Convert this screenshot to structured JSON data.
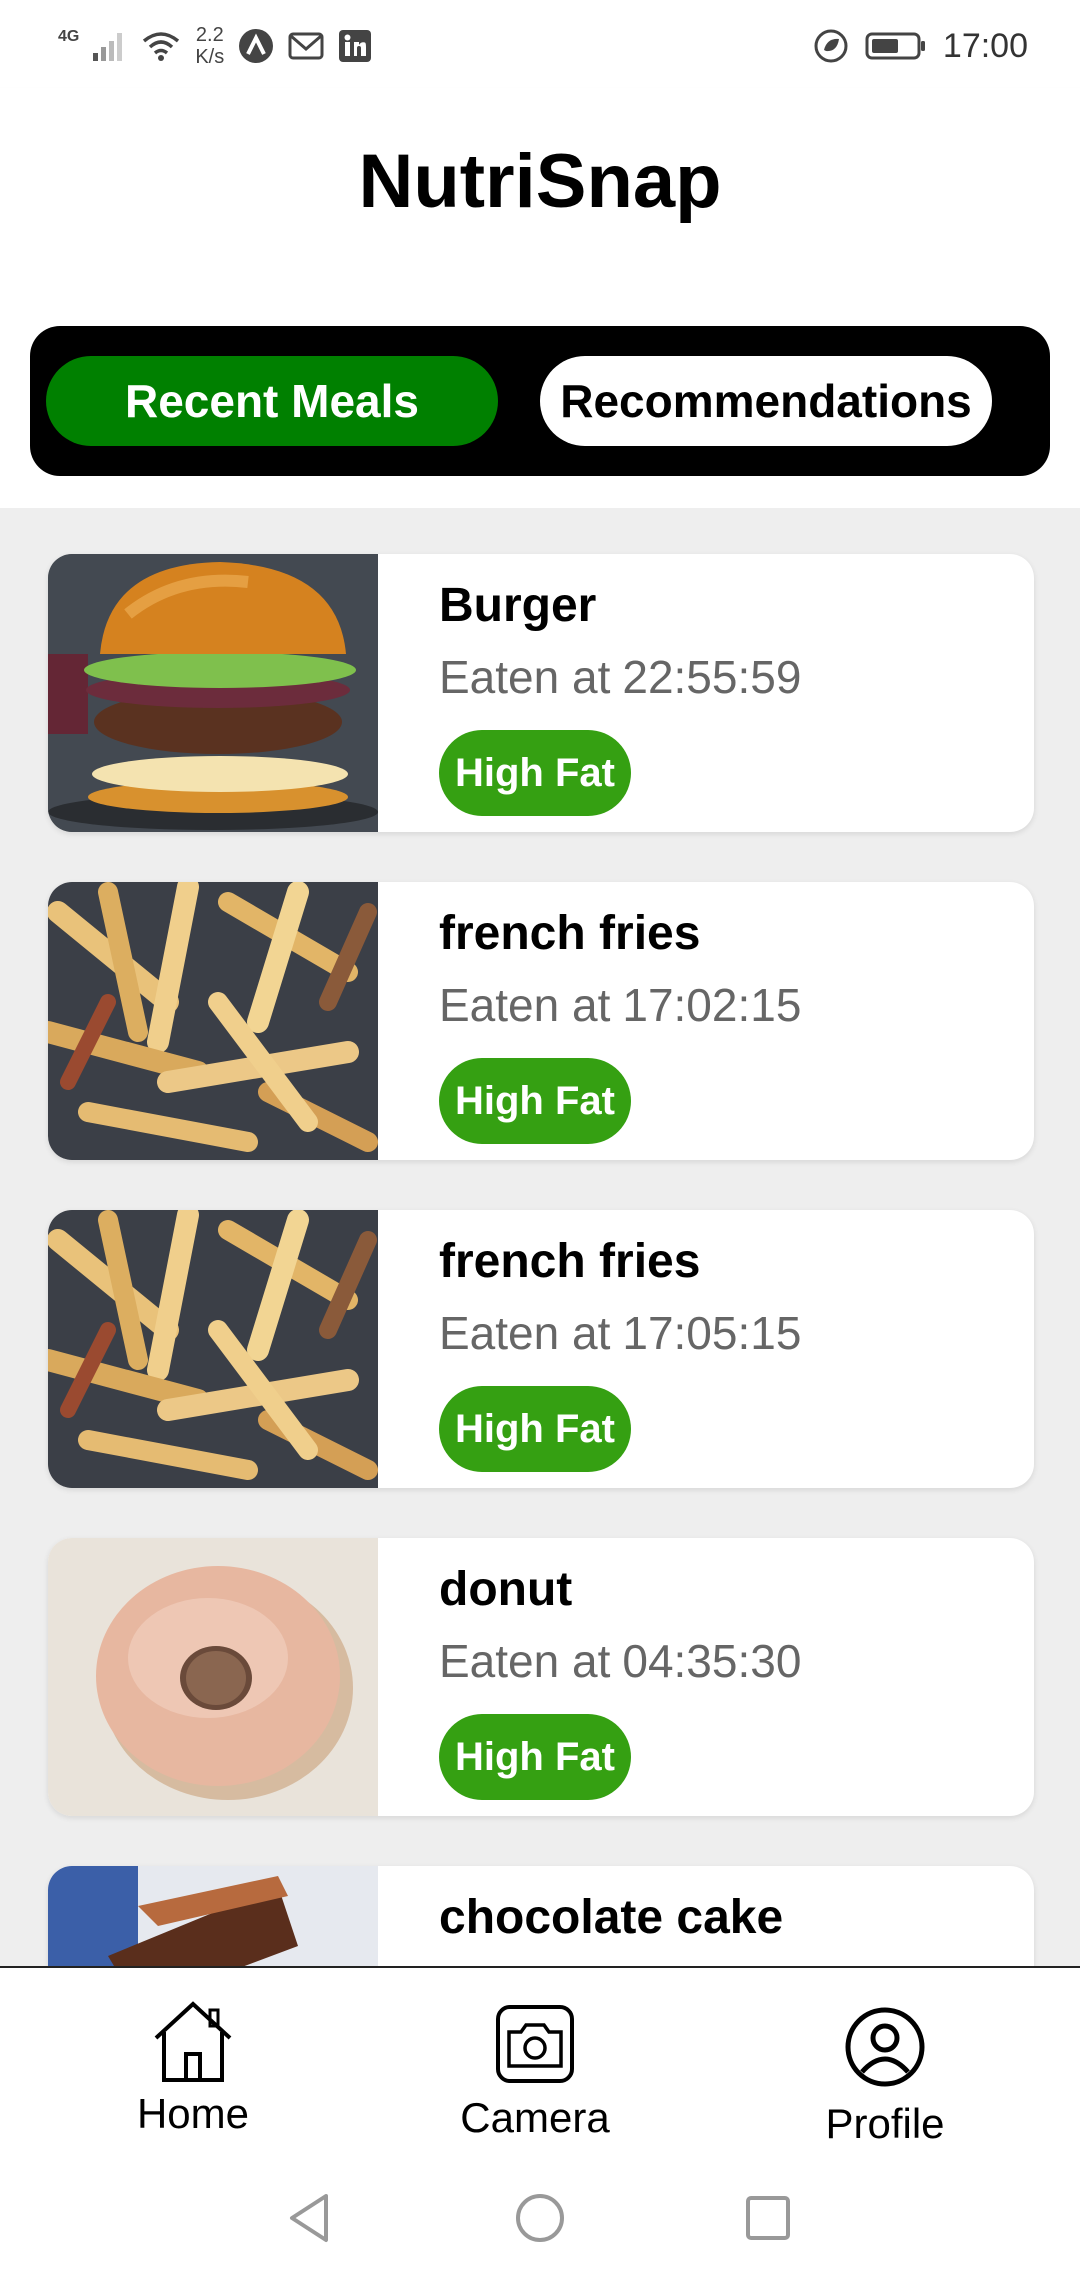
{
  "status_bar": {
    "network_type": "4G",
    "speed_value": "2.2",
    "speed_unit": "K/s",
    "time": "17:00",
    "icons": [
      "signal-icon",
      "wifi-icon",
      "app-a-icon",
      "gmail-icon",
      "linkedin-icon",
      "eco-icon",
      "battery-icon"
    ]
  },
  "header": {
    "title": "NutriSnap"
  },
  "tabs": [
    {
      "label": "Recent Meals",
      "active": true
    },
    {
      "label": "Recommendations",
      "active": false
    }
  ],
  "meals": [
    {
      "name": "Burger",
      "time_prefix": "Eaten at",
      "time": "22:55:59",
      "badge": "High Fat",
      "image": "burger"
    },
    {
      "name": "french fries",
      "time_prefix": "Eaten at",
      "time": "17:02:15",
      "badge": "High Fat",
      "image": "fries"
    },
    {
      "name": "french fries",
      "time_prefix": "Eaten at",
      "time": "17:05:15",
      "badge": "High Fat",
      "image": "fries"
    },
    {
      "name": "donut",
      "time_prefix": "Eaten at",
      "time": "04:35:30",
      "badge": "High Fat",
      "image": "donut"
    },
    {
      "name": "chocolate cake",
      "image": "cake"
    }
  ],
  "bottom_nav": [
    {
      "label": "Home",
      "icon": "home-icon"
    },
    {
      "label": "Camera",
      "icon": "camera-icon"
    },
    {
      "label": "Profile",
      "icon": "profile-icon"
    }
  ],
  "colors": {
    "active_tab": "#008000",
    "badge": "#35a012",
    "tab_bar": "#000000",
    "list_background": "#eeeeee"
  }
}
